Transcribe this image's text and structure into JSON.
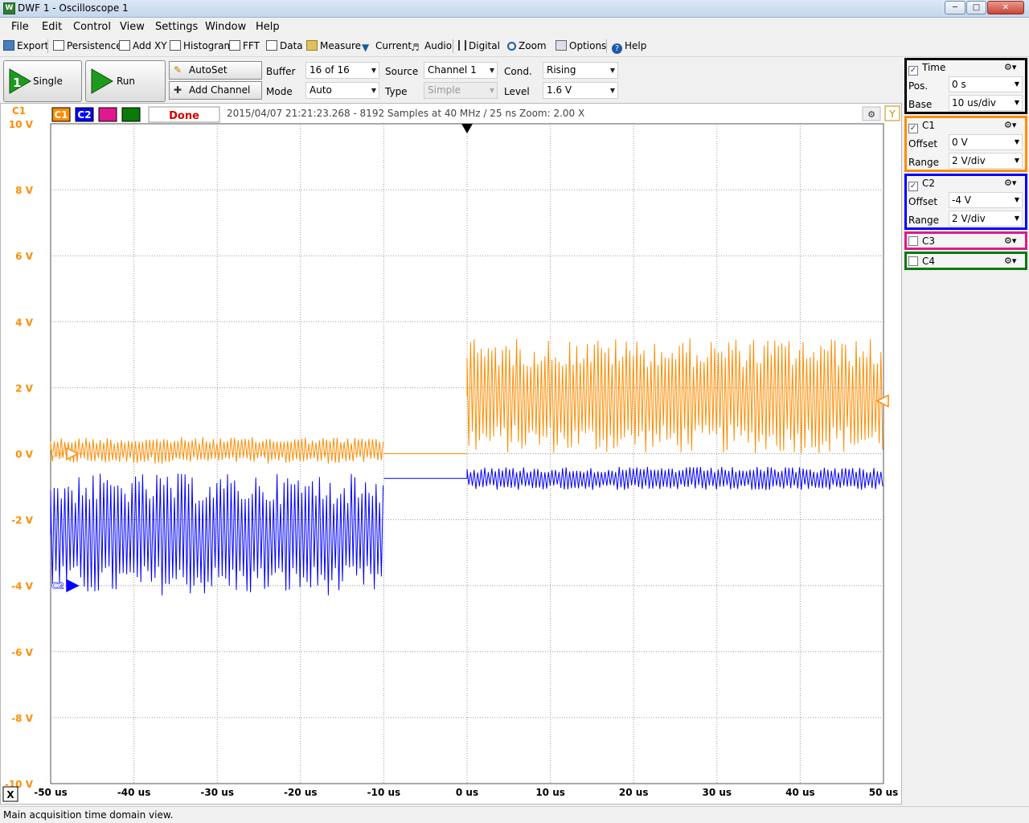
{
  "window": {
    "title": "DWF 1 - Oscilloscope 1",
    "app_icon": "W"
  },
  "menu": [
    "File",
    "Edit",
    "Control",
    "View",
    "Settings",
    "Window",
    "Help"
  ],
  "toolbar": [
    "Export",
    "Persistence",
    "Add XY",
    "Histogram",
    "FFT",
    "Data",
    "Measure",
    "Current",
    "Audio",
    "Digital",
    "Zoom",
    "Options",
    "Help"
  ],
  "controls": {
    "single": "Single",
    "single_badge": "1",
    "run": "Run",
    "autoset": "AutoSet",
    "add_channel": "Add Channel",
    "buffer_label": "Buffer",
    "buffer_value": "16 of 16",
    "mode_label": "Mode",
    "mode_value": "Auto",
    "source_label": "Source",
    "source_value": "Channel 1",
    "type_label": "Type",
    "type_value": "Simple",
    "cond_label": "Cond.",
    "cond_value": "Rising",
    "level_label": "Level",
    "level_value": "1.6 V"
  },
  "plot": {
    "axis_name": "C1",
    "channel_tabs": [
      "C1",
      "C2",
      "C3",
      "C4"
    ],
    "state": "Done",
    "info": "2015/04/07 21:21:23.268 - 8192 Samples at 40 MHz / 25 ns Zoom: 2.00 X",
    "y_button": "Y",
    "x_button": "X",
    "c1_marker": "C1",
    "c2_marker": "C2"
  },
  "chart_data": {
    "type": "line",
    "x_unit": "us",
    "y_unit": "V",
    "xlim": [
      -50,
      50
    ],
    "ylim": [
      -10,
      10
    ],
    "x_ticks": [
      "-50 us",
      "-40 us",
      "-30 us",
      "-20 us",
      "-10 us",
      "0 us",
      "10 us",
      "20 us",
      "30 us",
      "40 us",
      "50 us"
    ],
    "y_ticks": [
      "10 V",
      "8 V",
      "6 V",
      "4 V",
      "2 V",
      "0 V",
      "-2 V",
      "-4 V",
      "-6 V",
      "-8 V",
      "-10 V"
    ],
    "trigger_time": 0,
    "trigger_level": 1.6,
    "series": [
      {
        "name": "C1",
        "color": "#ff8c00",
        "segments": [
          {
            "x": [
              -50,
              -10
            ],
            "min": -0.3,
            "max": 0.5
          },
          {
            "x": [
              -10,
              0
            ],
            "min": 0,
            "max": 0
          },
          {
            "x": [
              0,
              50
            ],
            "min": 0,
            "max": 3.5
          }
        ],
        "marker_level": 0
      },
      {
        "name": "C2",
        "color": "#0000ff",
        "segments": [
          {
            "x": [
              -50,
              -10
            ],
            "min": -4.3,
            "max": -0.6
          },
          {
            "x": [
              -10,
              0
            ],
            "min": -0.75,
            "max": -0.75
          },
          {
            "x": [
              0,
              50
            ],
            "min": -1.1,
            "max": -0.4
          }
        ],
        "marker_level": -4
      }
    ]
  },
  "side": {
    "time": {
      "title": "Time",
      "pos_label": "Pos.",
      "pos_value": "0 s",
      "base_label": "Base",
      "base_value": "10 us/div"
    },
    "c1": {
      "title": "C1",
      "offset_label": "Offset",
      "offset_value": "0 V",
      "range_label": "Range",
      "range_value": "2 V/div",
      "color": "#ff8c00"
    },
    "c2": {
      "title": "C2",
      "offset_label": "Offset",
      "offset_value": "-4 V",
      "range_label": "Range",
      "range_value": "2 V/div",
      "color": "#0000ff"
    },
    "c3": {
      "title": "C3",
      "color": "#e0198c"
    },
    "c4": {
      "title": "C4",
      "color": "#0a7a0a"
    }
  },
  "status": "Main acquisition time domain view."
}
